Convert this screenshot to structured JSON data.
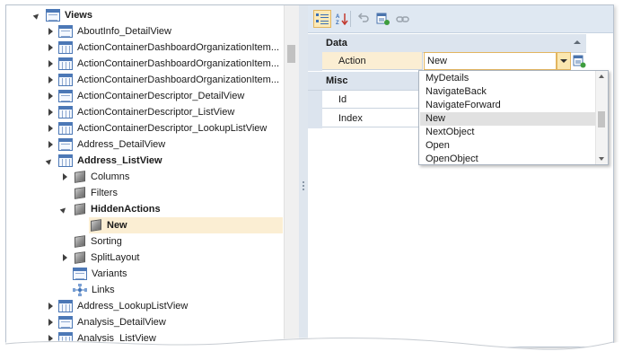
{
  "tree": {
    "root": {
      "label": "Views"
    },
    "items": [
      {
        "label": "AboutInfo_DetailView",
        "icon": "detail-view-icon"
      },
      {
        "label": "ActionContainerDashboardOrganizationItem...",
        "icon": "list-view-icon"
      },
      {
        "label": "ActionContainerDashboardOrganizationItem...",
        "icon": "list-view-icon"
      },
      {
        "label": "ActionContainerDashboardOrganizationItem...",
        "icon": "list-view-icon"
      },
      {
        "label": "ActionContainerDescriptor_DetailView",
        "icon": "detail-view-icon"
      },
      {
        "label": "ActionContainerDescriptor_ListView",
        "icon": "list-view-icon"
      },
      {
        "label": "ActionContainerDescriptor_LookupListView",
        "icon": "list-view-icon"
      },
      {
        "label": "Address_DetailView",
        "icon": "detail-view-icon"
      },
      {
        "label": "Address_ListView",
        "icon": "list-view-icon"
      }
    ],
    "children": [
      {
        "label": "Columns"
      },
      {
        "label": "Filters"
      },
      {
        "label": "HiddenActions"
      },
      {
        "label": "New"
      },
      {
        "label": "Sorting"
      },
      {
        "label": "SplitLayout"
      },
      {
        "label": "Variants"
      },
      {
        "label": "Links"
      }
    ],
    "after": [
      {
        "label": "Address_LookupListView",
        "icon": "list-view-icon"
      },
      {
        "label": "Analysis_DetailView",
        "icon": "detail-view-icon"
      },
      {
        "label": "Analysis_ListView",
        "icon": "list-view-icon"
      }
    ]
  },
  "properties": {
    "categories": [
      {
        "name": "Data"
      },
      {
        "name": "Misc"
      }
    ],
    "rows": [
      {
        "name": "Action",
        "value": "New"
      },
      {
        "name": "Id",
        "value": ""
      },
      {
        "name": "Index",
        "value": ""
      }
    ]
  },
  "dropdown": {
    "options": [
      "MyDetails",
      "NavigateBack",
      "NavigateForward",
      "New",
      "NextObject",
      "Open",
      "OpenObject"
    ],
    "selected": "New"
  },
  "colors": {
    "selection": "#fbeed3",
    "category_bg": "#dce4ee",
    "toolbar_bg": "#dfe8f2",
    "accent_border": "#e2b55f"
  }
}
